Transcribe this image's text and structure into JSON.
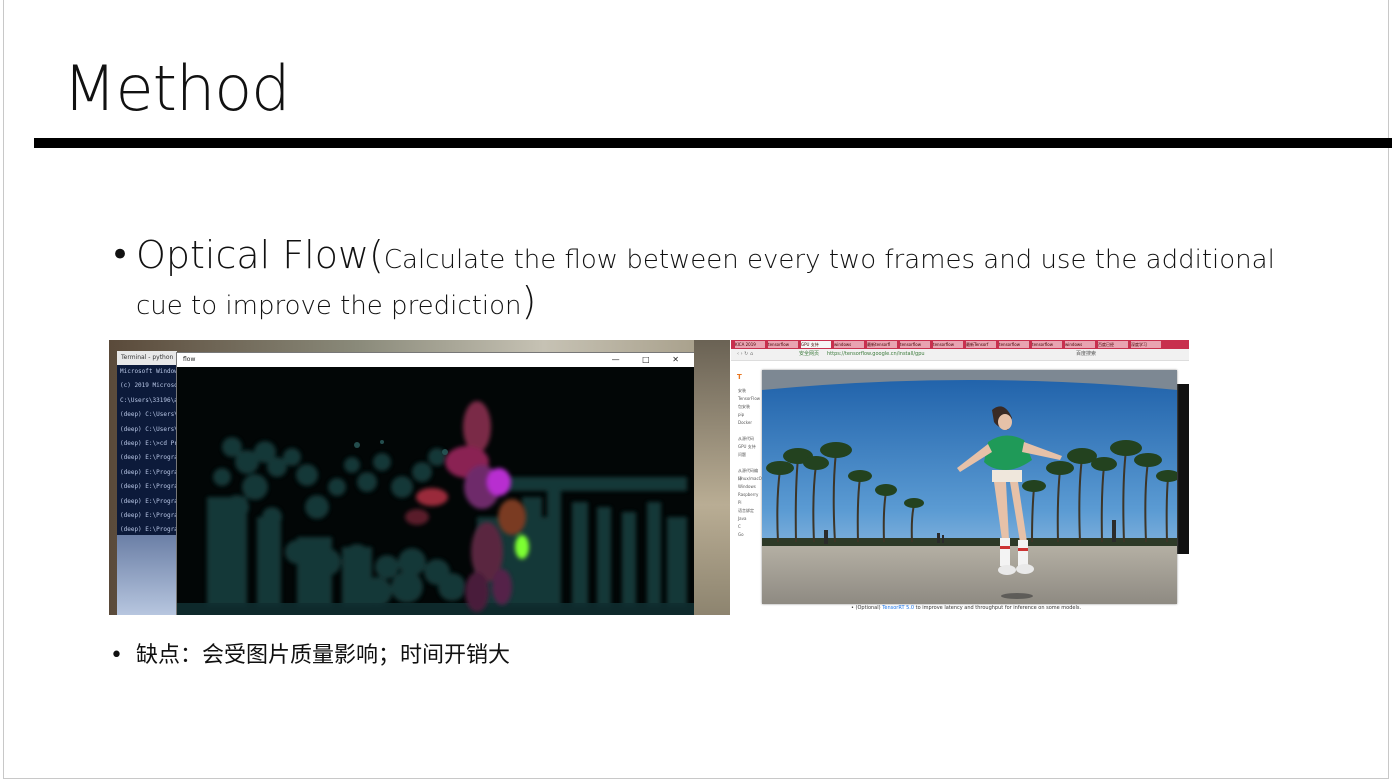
{
  "slide": {
    "title": "Method",
    "bullet1": {
      "marker": "•",
      "heading": "Optical Flow(",
      "description": "Calculate the flow between every two frames and use the additional cue to improve the prediction",
      "close": ")"
    },
    "bullet2": {
      "marker": "•",
      "text": "缺点：会受图片质量影响；时间开销大"
    }
  },
  "screenshot_flow": {
    "terminal_title": "Terminal - python",
    "terminal_lines": [
      "Microsoft Windows",
      "(c) 2019 Microsoft",
      "C:\\Users\\33196\\aci",
      "(deep) C:\\Users\\",
      "(deep) C:\\Users\\",
      "(deep) E:\\>cd Pro",
      "(deep) E:\\Program",
      "(deep) E:\\Program",
      "(deep) E:\\Program",
      "(deep) E:\\Program",
      "(deep) E:\\Program",
      "(deep) E:\\Program",
      "(deep) E:\\Program"
    ],
    "flow_window_title": "flow",
    "window_controls": "— □ ✕"
  },
  "screenshot_browser": {
    "tabs": [
      "KICA 2019",
      "tensorflow",
      "GPU 支持",
      "windows",
      "最新tensorfl",
      "tensorflow",
      "tensorflow",
      "最新Tensorf",
      "tensorflow",
      "tensorflow",
      "windows",
      "百度已经",
      "深度学习"
    ],
    "secure_label": "安全网页",
    "url": "https://tensorflow.google.cn/install/gpu",
    "search_hint": "百度搜索",
    "logo_text": "TensorFlow",
    "nav_items": [
      "安装 TensorFlow",
      "",
      "包安装",
      "pip",
      "Docker",
      "",
      "从源代码",
      "GPU 支持",
      "问题",
      "",
      "从源代码编译",
      "Linux/macOS",
      "Windows",
      "Raspberry Pi",
      "",
      "语言绑定",
      "Java",
      "C",
      "Go"
    ],
    "footer_prefix": "• (Optional)",
    "footer_link": "TensorRT 5.0",
    "footer_rest": "to improve latency and throughput for inference on some models."
  }
}
